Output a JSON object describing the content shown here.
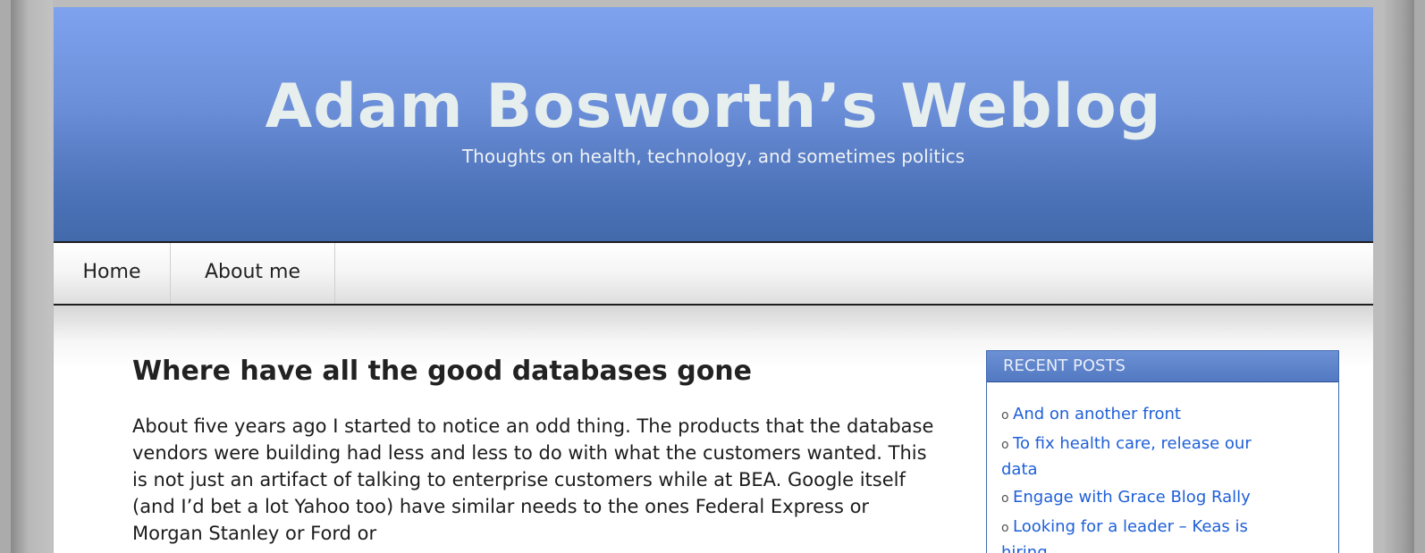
{
  "site": {
    "title": "Adam Bosworth’s Weblog",
    "tagline": "Thoughts on health, technology, and sometimes politics"
  },
  "nav": {
    "items": [
      {
        "label": "Home"
      },
      {
        "label": "About me"
      }
    ]
  },
  "post": {
    "title": "Where have all the good databases gone",
    "body": "About five years ago I started to notice an odd thing. The products that the database vendors were building had less and less to do with what the customers wanted. This is not just an artifact of talking to enterprise customers while at BEA. Google itself (and I’d bet a lot Yahoo too) have similar needs to the ones Federal Express or Morgan Stanley or Ford or"
  },
  "sidebar": {
    "recent_posts": {
      "title": "RECENT POSTS",
      "bullet": "o",
      "items": [
        {
          "label": "And on another front"
        },
        {
          "label": "To fix health care, release our data"
        },
        {
          "label": "Engage with Grace Blog Rally"
        },
        {
          "label": "Looking for a leader – Keas is hiring"
        }
      ]
    }
  },
  "colors": {
    "header_top": "#7ea2ee",
    "header_bottom": "#426aab",
    "link": "#1e5fd8",
    "widget_header": "#5279c2"
  }
}
